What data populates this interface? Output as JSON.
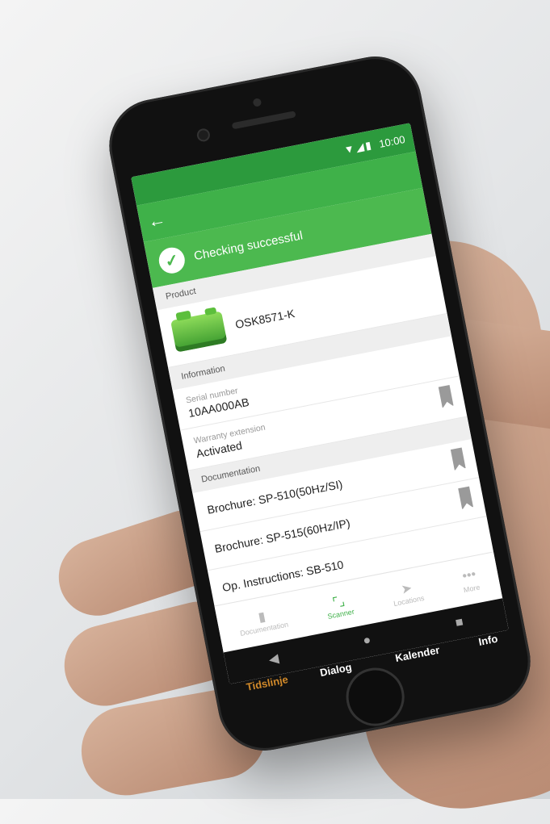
{
  "status_bar": {
    "icons": "▼◢▮",
    "time": "10:00"
  },
  "app_bar": {
    "back_icon": "←"
  },
  "banner": {
    "text": "Checking successful"
  },
  "product": {
    "section": "Product",
    "name": "OSK8571-K"
  },
  "information": {
    "section": "Information",
    "serial_label": "Serial number",
    "serial_value": "10AA000AB",
    "warranty_label": "Warranty extension",
    "warranty_value": "Activated"
  },
  "documentation": {
    "section": "Documentation",
    "items": [
      "Brochure: SP-510(50Hz/SI)",
      "Brochure: SP-515(60Hz/IP)",
      "Op. Instructions: SB-510"
    ]
  },
  "bottom_nav": [
    {
      "label": "Documentation",
      "icon": "▮"
    },
    {
      "label": "Scanner",
      "icon": "⌜⌟"
    },
    {
      "label": "Locations",
      "icon": "➤"
    },
    {
      "label": "More",
      "icon": "•••"
    }
  ],
  "android_nav": {
    "back": "◀",
    "home": "●",
    "recent": "■"
  },
  "outer_tabs": [
    "Tidslinje",
    "Dialog",
    "Kalender",
    "Info"
  ],
  "colors": {
    "primary_green": "#3fb149",
    "dark_green": "#2c9a3d",
    "active_tab": "#d28a2a"
  }
}
